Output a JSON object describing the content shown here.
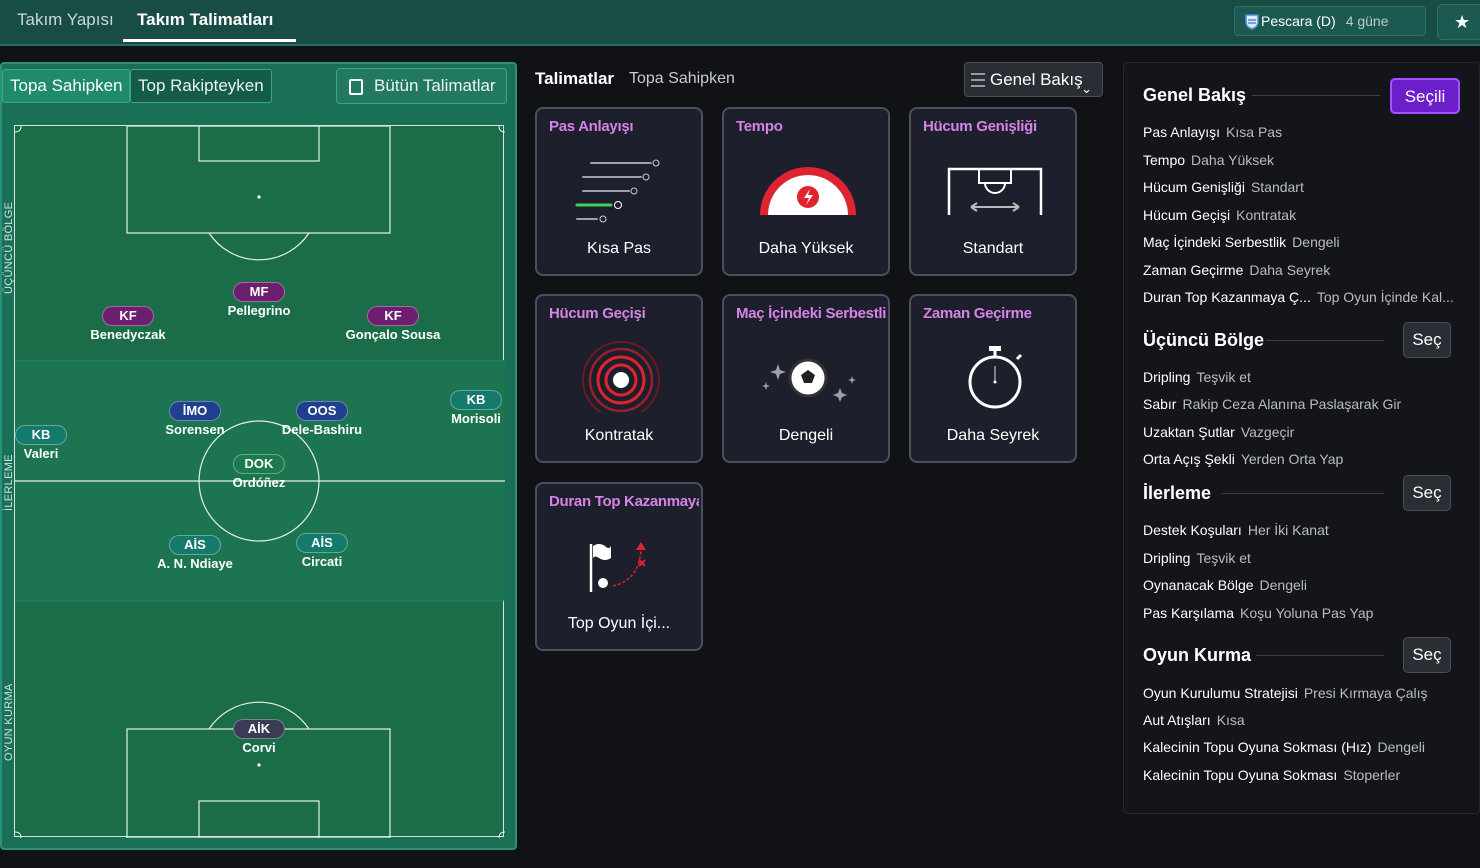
{
  "topbar": {
    "tabs": [
      "Takım Yapısı",
      "Takım Talimatları"
    ],
    "match": {
      "opponent": "Pescara (D)",
      "days": "4 güne"
    },
    "star": "★"
  },
  "pitch_panel": {
    "tabs": [
      "Topa Sahipken",
      "Top Rakipteyken"
    ],
    "all_button": "Bütün Talimatlar",
    "zones": [
      "ÜÇÜNCÜ BÖLGE",
      "İLERLEME",
      "OYUN KURMA"
    ],
    "players": [
      {
        "role": "MF",
        "name": "Pellegrino"
      },
      {
        "role": "KF",
        "name": "Benedyczak"
      },
      {
        "role": "KF",
        "name": "Gonçalo Sousa"
      },
      {
        "role": "İMO",
        "name": "Sorensen"
      },
      {
        "role": "OOS",
        "name": "Dele-Bashiru"
      },
      {
        "role": "KB",
        "name": "Morisoli"
      },
      {
        "role": "KB",
        "name": "Valeri"
      },
      {
        "role": "DOK",
        "name": "Ordóñez"
      },
      {
        "role": "AİS",
        "name": "A. N. Ndiaye"
      },
      {
        "role": "AİS",
        "name": "Circati"
      },
      {
        "role": "AİK",
        "name": "Corvi"
      }
    ]
  },
  "middle": {
    "title": "Talimatlar",
    "subtitle": "Topa Sahipken",
    "view_select": "Genel Bakış",
    "cards": [
      {
        "title": "Pas Anlayışı",
        "value": "Kısa Pas",
        "icon": "passing-icon"
      },
      {
        "title": "Tempo",
        "value": "Daha Yüksek",
        "icon": "tempo-gauge-icon"
      },
      {
        "title": "Hücum Genişliği",
        "value": "Standart",
        "icon": "width-icon"
      },
      {
        "title": "Hücum Geçişi",
        "value": "Kontratak",
        "icon": "target-icon"
      },
      {
        "title": "Maç İçindeki Serbestlik",
        "value": "Dengeli",
        "icon": "ball-sparkle-icon"
      },
      {
        "title": "Zaman Geçirme",
        "value": "Daha Seyrek",
        "icon": "stopwatch-icon"
      },
      {
        "title": "Duran Top Kazanmaya",
        "value": "Top Oyun İçi...",
        "icon": "flag-ball-icon"
      }
    ]
  },
  "right": {
    "sections": [
      {
        "title": "Genel Bakış",
        "button": "Seçili",
        "rows": [
          {
            "k": "Pas Anlayışı",
            "v": "Kısa Pas"
          },
          {
            "k": "Tempo",
            "v": "Daha Yüksek"
          },
          {
            "k": "Hücum Genişliği",
            "v": "Standart"
          },
          {
            "k": "Hücum Geçişi",
            "v": "Kontratak"
          },
          {
            "k": "Maç İçindeki Serbestlik",
            "v": "Dengeli"
          },
          {
            "k": "Zaman Geçirme",
            "v": "Daha Seyrek"
          },
          {
            "k": "Duran Top Kazanmaya Ç...",
            "v": "Top Oyun İçinde Kal..."
          }
        ]
      },
      {
        "title": "Üçüncü Bölge",
        "button": "Seç",
        "rows": [
          {
            "k": "Dripling",
            "v": "Teşvik et"
          },
          {
            "k": "Sabır",
            "v": "Rakip Ceza Alanına Paslaşarak Gir"
          },
          {
            "k": "Uzaktan Şutlar",
            "v": "Vazgeçir"
          },
          {
            "k": "Orta Açış Şekli",
            "v": "Yerden Orta Yap"
          }
        ]
      },
      {
        "title": "İlerleme",
        "button": "Seç",
        "rows": [
          {
            "k": "Destek Koşuları",
            "v": "Her İki Kanat"
          },
          {
            "k": "Dripling",
            "v": "Teşvik et"
          },
          {
            "k": "Oynanacak Bölge",
            "v": "Dengeli"
          },
          {
            "k": "Pas Karşılama",
            "v": "Koşu Yoluna Pas Yap"
          }
        ]
      },
      {
        "title": "Oyun Kurma",
        "button": "Seç",
        "rows": [
          {
            "k": "Oyun Kurulumu Stratejisi",
            "v": "Presi Kırmaya Çalış"
          },
          {
            "k": "Aut Atışları",
            "v": "Kısa"
          },
          {
            "k": "Kalecinin Topu Oyuna Sokması (Hız)",
            "v": "Dengeli"
          },
          {
            "k": "Kalecinin Topu Oyuna Sokması",
            "v": "Stoperler"
          }
        ]
      }
    ]
  },
  "colors": {
    "accent": "#6b1ec9",
    "pitch": "#1b6d4a",
    "card_title": "#d583e6",
    "tempo_red": "#e0242f"
  }
}
